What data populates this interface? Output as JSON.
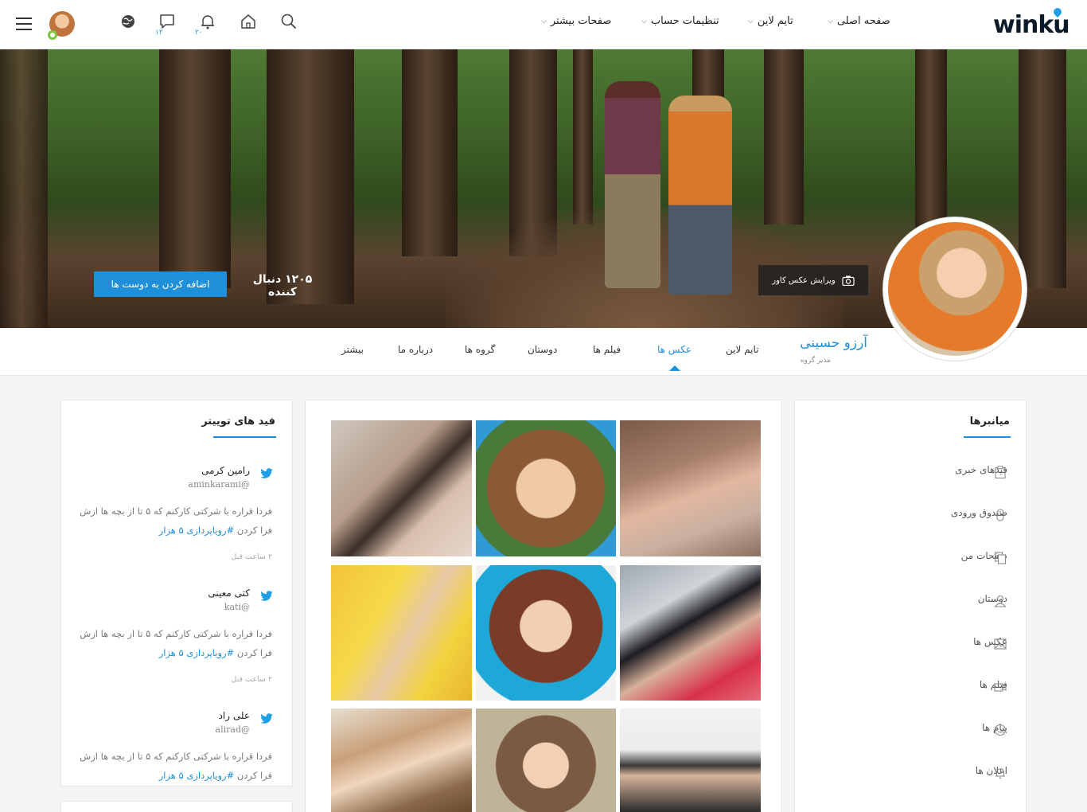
{
  "header": {
    "logo": "winku",
    "nav": [
      {
        "label": "صفحه اصلی"
      },
      {
        "label": "تایم لاین"
      },
      {
        "label": "تنظیمات حساب"
      },
      {
        "label": "صفحات بیشتر"
      }
    ],
    "messages_count": "۱۲",
    "notifications_count": "۲۰"
  },
  "cover": {
    "edit_cover_label": "ویرایش عکس کاور",
    "followers_label": "۱۲۰۵ دنبال کننده",
    "add_friend_label": "اضافه کردن به دوست ها"
  },
  "profile": {
    "name": "آرزو حسینی",
    "role": "مدیر گروه"
  },
  "tabs": [
    {
      "label": "تایم لاین"
    },
    {
      "label": "عکس ها"
    },
    {
      "label": "فیلم ها"
    },
    {
      "label": "دوستان"
    },
    {
      "label": "گروه ها"
    },
    {
      "label": "درباره ما"
    },
    {
      "label": "بیشتر"
    }
  ],
  "shortcuts": {
    "title": "میانبرها",
    "items": [
      {
        "label": "فیدهای خبری",
        "icon": "clipboard-icon"
      },
      {
        "label": "صندوق ورودی",
        "icon": "mouse-icon"
      },
      {
        "label": "صفحات من",
        "icon": "files-icon"
      },
      {
        "label": "دوستان",
        "icon": "user-icon"
      },
      {
        "label": "عکس ها",
        "icon": "image-icon"
      },
      {
        "label": "فیلم ها",
        "icon": "video-icon"
      },
      {
        "label": "پیام ها",
        "icon": "chat-icon"
      },
      {
        "label": "اعلان ها",
        "icon": "bell-icon"
      }
    ]
  },
  "twitter": {
    "title": "فید های توییتر",
    "tweets": [
      {
        "name": "رامین کرمی",
        "handle": "@aminkarami",
        "text": "فردا قراره با شرکتی کارکنم که ۵ تا از بچه ها ازش فرا کردن",
        "tag": "#رویاپردازی ۵ هزار",
        "time": "۲ ساعت قبل"
      },
      {
        "name": "کتی معینی",
        "handle": "@kati",
        "text": "فردا قراره با شرکتی کارکنم که ۵ تا از بچه ها ازش فرا کردن",
        "tag": "#رویاپردازی ۵ هزار",
        "time": "۲ ساعت قبل"
      },
      {
        "name": "علی راد",
        "handle": "@alirad",
        "text": "فردا قراره با شرکتی کارکنم که ۵ تا از بچه ها ازش فرا کردن",
        "tag": "#رویاپردازی ۵ هزار",
        "time": ""
      }
    ]
  },
  "colors": {
    "accent": "#1e8fd8",
    "twitter": "#1ea0e6",
    "online": "#7cc53b"
  }
}
